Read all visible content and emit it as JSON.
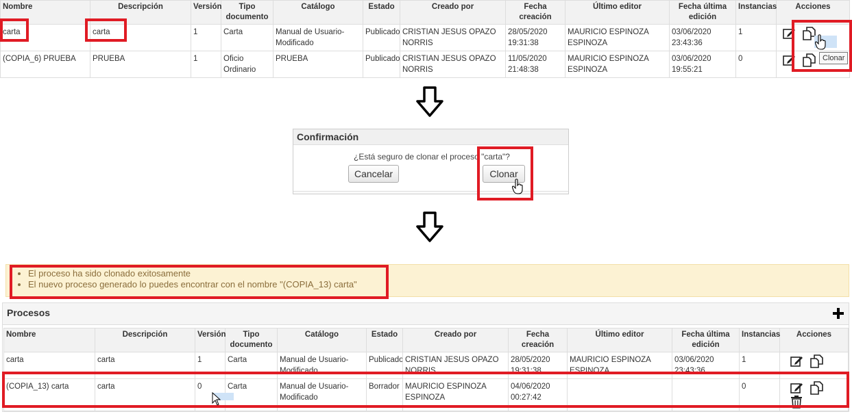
{
  "table_headers": [
    "Nombre",
    "Descripción",
    "Versión",
    "Tipo documento",
    "Catálogo",
    "Estado",
    "Creado por",
    "Fecha creación",
    "Último editor",
    "Fecha última edición",
    "Instancias",
    "Acciones"
  ],
  "top_rows": [
    {
      "nombre": "carta",
      "descripcion": "carta",
      "version": "1",
      "tipo": "Carta",
      "catalogo": "Manual de Usuario-Modificado",
      "estado": "Publicado",
      "creado_por": "CRISTIAN JESUS OPAZO NORRIS",
      "fecha_creacion": "28/05/2020 19:31:38",
      "ultimo_editor": "MAURICIO ESPINOZA ESPINOZA",
      "fecha_edicion": "03/06/2020 23:43:36",
      "instancias": "1"
    },
    {
      "nombre": "(COPIA_6) PRUEBA",
      "descripcion": "PRUEBA",
      "version": "1",
      "tipo": "Oficio Ordinario",
      "catalogo": "PRUEBA",
      "estado": "Publicado",
      "creado_por": "CRISTIAN JESUS OPAZO NORRIS",
      "fecha_creacion": "11/05/2020 21:48:38",
      "ultimo_editor": "MAURICIO ESPINOZA ESPINOZA",
      "fecha_edicion": "03/06/2020 19:55:21",
      "instancias": "0"
    }
  ],
  "tooltip": "Clonar",
  "dialog": {
    "title": "Confirmación",
    "message": "¿Está seguro de clonar el proceso \"carta\"?",
    "cancel_label": "Cancelar",
    "confirm_label": "Clonar"
  },
  "alert": {
    "lines": [
      "El proceso ha sido clonado exitosamente",
      "El nuevo proceso generado lo puedes encontrar con el nombre \"(COPIA_13) carta\""
    ]
  },
  "panel": {
    "title": "Procesos"
  },
  "bottom_rows": [
    {
      "nombre": "carta",
      "descripcion": "carta",
      "version": "1",
      "tipo": "Carta",
      "catalogo": "Manual de Usuario-Modificado",
      "estado": "Publicado",
      "creado_por": "CRISTIAN JESUS OPAZO NORRIS",
      "fecha_creacion": "28/05/2020 19:31:38",
      "ultimo_editor": "MAURICIO ESPINOZA ESPINOZA",
      "fecha_edicion": "03/06/2020 23:43:36",
      "instancias": "1"
    },
    {
      "nombre": "(COPIA_13) carta",
      "descripcion": "carta",
      "version": "0",
      "tipo": "Carta",
      "catalogo": "Manual de Usuario-Modificado",
      "estado": "Borrador",
      "creado_por": "MAURICIO ESPINOZA ESPINOZA",
      "fecha_creacion": "04/06/2020 00:27:42",
      "ultimo_editor": "",
      "fecha_edicion": "",
      "instancias": "0"
    }
  ],
  "colors": {
    "highlight": "#e01b24",
    "alert_bg": "#fcf2d3",
    "alert_text": "#8a6d3b"
  },
  "icons": [
    "edit-icon",
    "clone-icon",
    "trash-icon",
    "plus-icon",
    "down-arrow-icon",
    "hand-cursor-icon",
    "arrow-cursor-icon"
  ]
}
